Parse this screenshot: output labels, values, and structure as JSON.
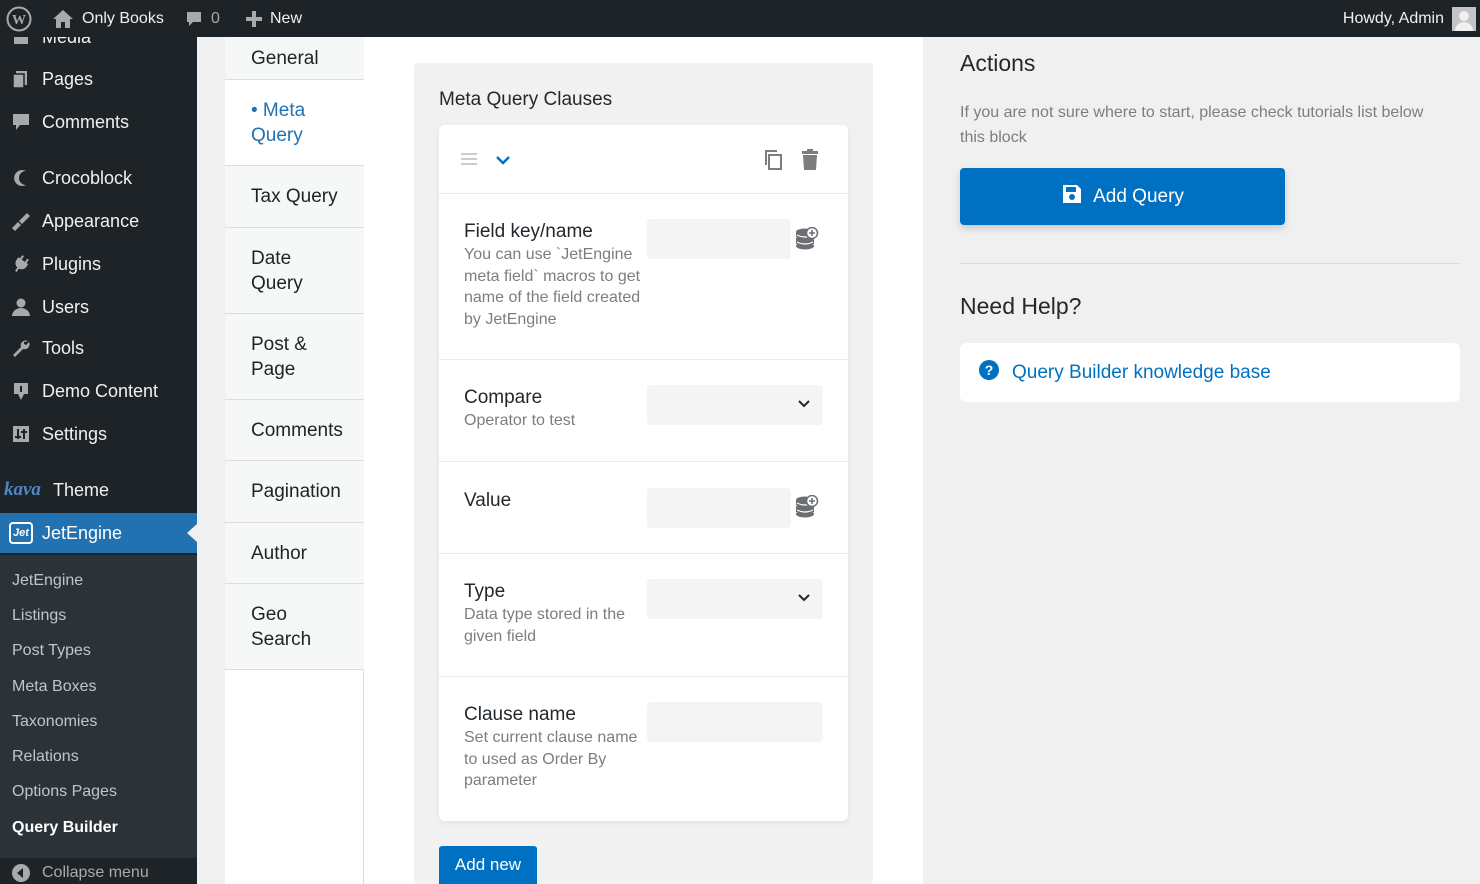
{
  "adminbar": {
    "site_name": "Only Books",
    "comments_count": "0",
    "new_label": "New",
    "howdy": "Howdy, Admin"
  },
  "sidebar": {
    "media_label": "Media",
    "items": [
      {
        "label": "Pages",
        "icon": "pages-icon"
      },
      {
        "label": "Comments",
        "icon": "comments-icon"
      },
      {
        "label": "Crocoblock",
        "icon": "crocoblock-icon"
      },
      {
        "label": "Appearance",
        "icon": "appearance-icon"
      },
      {
        "label": "Plugins",
        "icon": "plugins-icon"
      },
      {
        "label": "Users",
        "icon": "users-icon"
      },
      {
        "label": "Tools",
        "icon": "tools-icon"
      },
      {
        "label": "Demo Content",
        "icon": "demo-content-icon"
      },
      {
        "label": "Settings",
        "icon": "settings-icon"
      },
      {
        "label": "Theme",
        "icon": "kava-logo",
        "logo_text": "kava"
      },
      {
        "label": "JetEngine",
        "icon": "jetengine-icon",
        "logo_text": "Jet"
      }
    ],
    "submenu": [
      "JetEngine",
      "Listings",
      "Post Types",
      "Meta Boxes",
      "Taxonomies",
      "Relations",
      "Options Pages",
      "Query Builder"
    ],
    "collapse_label": "Collapse menu",
    "accent_color": "#2271b1"
  },
  "tabs": [
    {
      "label": "General"
    },
    {
      "label": "• Meta Query",
      "active": true
    },
    {
      "label": "Tax Query"
    },
    {
      "label": "Date Query"
    },
    {
      "label": "Post & Page"
    },
    {
      "label": "Comments"
    },
    {
      "label": "Pagination"
    },
    {
      "label": "Author"
    },
    {
      "label": "Geo Search"
    }
  ],
  "meta_query": {
    "title": "Meta Query Clauses",
    "fields": {
      "field_key": {
        "label": "Field key/name",
        "desc": "You can use `JetEngine meta field` macros to get name of the field created by JetEngine",
        "value": ""
      },
      "compare": {
        "label": "Compare",
        "desc": "Operator to test",
        "value": ""
      },
      "value": {
        "label": "Value",
        "value": ""
      },
      "type": {
        "label": "Type",
        "desc": "Data type stored in the given field",
        "value": ""
      },
      "clause_name": {
        "label": "Clause name",
        "desc": "Set current clause name to used as Order By parameter",
        "value": ""
      }
    },
    "add_new_label": "Add new"
  },
  "actions": {
    "title": "Actions",
    "desc": "If you are not sure where to start, please check tutorials list below this block",
    "add_query_label": "Add Query",
    "button_color": "#0071c2"
  },
  "help": {
    "title": "Need Help?",
    "link_label": "Query Builder knowledge base"
  }
}
